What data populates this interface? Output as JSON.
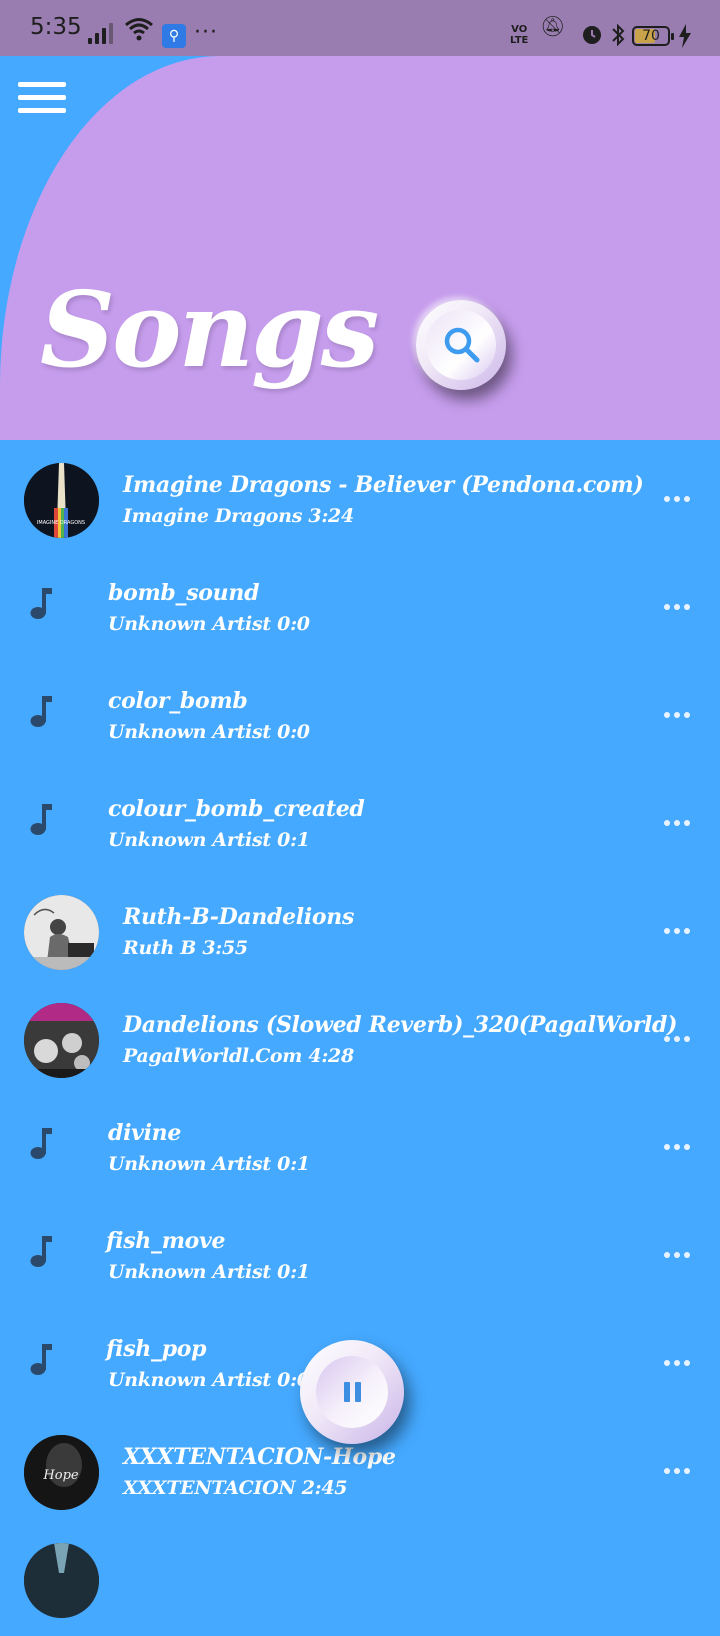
{
  "status_bar": {
    "time": "5:35",
    "more": "···",
    "volte": "VO\nLTE",
    "battery": "70"
  },
  "header": {
    "title": "Songs",
    "accent_color": "#c69ded",
    "background_color": "#45a9ff"
  },
  "songs": [
    {
      "title": "Imagine Dragons - Believer (Pendona.com)",
      "subtitle": "Imagine Dragons  3:24",
      "art": "album-art"
    },
    {
      "title": "bomb_sound",
      "subtitle": "Unknown Artist  0:0",
      "art": "music-note-icon"
    },
    {
      "title": "color_bomb",
      "subtitle": "Unknown Artist  0:0",
      "art": "music-note-icon"
    },
    {
      "title": "colour_bomb_created",
      "subtitle": "Unknown Artist  0:1",
      "art": "music-note-icon"
    },
    {
      "title": "Ruth-B-Dandelions",
      "subtitle": "Ruth B  3:55",
      "art": "album-art"
    },
    {
      "title": "Dandelions (Slowed Reverb)_320(PagalWorld)",
      "subtitle": "PagalWorldl.Com  4:28",
      "art": "album-art"
    },
    {
      "title": "divine",
      "subtitle": "Unknown Artist  0:1",
      "art": "music-note-icon"
    },
    {
      "title": "fish_move",
      "subtitle": "Unknown Artist  0:1",
      "art": "music-note-icon"
    },
    {
      "title": "fish_pop",
      "subtitle": "Unknown Artist  0:0",
      "art": "music-note-icon"
    },
    {
      "title": "XXXTENTACION-Hope",
      "subtitle": "XXXTENTACION  2:45",
      "art": "album-art"
    }
  ],
  "player": {
    "state": "playing"
  }
}
